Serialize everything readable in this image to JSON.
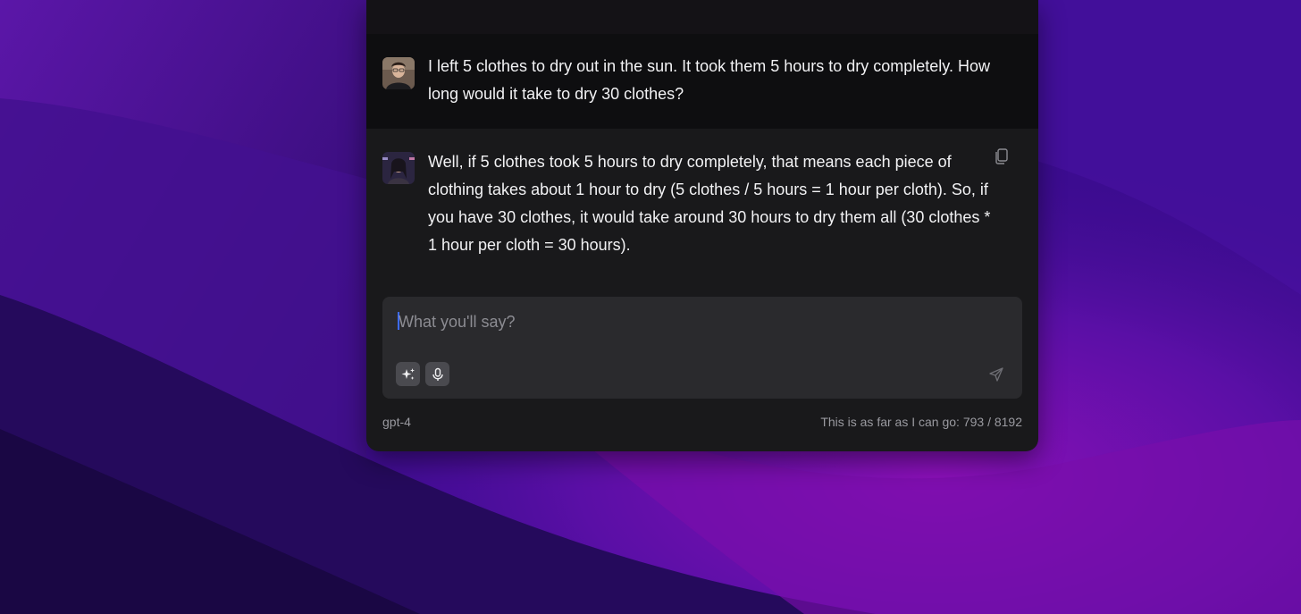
{
  "messages": [
    {
      "role": "user",
      "avatar_icon": "user-avatar",
      "text": "I left 5 clothes to dry out in the sun. It took them 5 hours to dry completely. How long would it take to dry 30 clothes?"
    },
    {
      "role": "assistant",
      "avatar_icon": "assistant-avatar",
      "text": "Well, if 5 clothes took 5 hours to dry completely, that means each piece of clothing takes about 1 hour to dry (5 clothes / 5 hours = 1 hour per cloth). So, if you have 30 clothes, it would take around 30 hours to dry them all (30 clothes * 1 hour per cloth = 30 hours)."
    }
  ],
  "composer": {
    "placeholder": "What you'll say?",
    "value": "",
    "tools": [
      "sparkles-icon",
      "microphone-icon"
    ],
    "send_icon": "send-icon"
  },
  "footer": {
    "model": "gpt-4",
    "status_label": "This is as far as I can go:",
    "token_count": "793 / 8192"
  },
  "colors": {
    "wallpaper_base": "#3a0c8c",
    "window_bg": "#19191b",
    "user_msg_bg": "#0e0e10",
    "input_bg": "#2a2a2d",
    "caret": "#3d6bff"
  }
}
